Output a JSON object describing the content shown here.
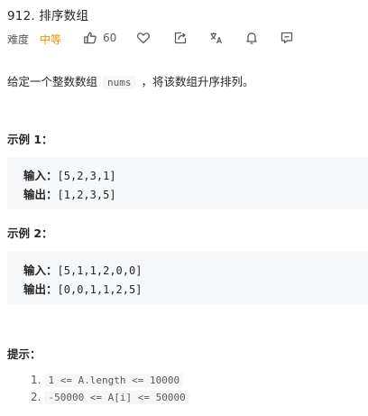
{
  "problem": {
    "title": "912. 排序数组",
    "difficulty_label": "难度",
    "difficulty": "中等",
    "likes": "60",
    "description_before": "给定一个整数数组",
    "description_code": "nums",
    "description_after": "，将该数组升序排列。"
  },
  "icons": {
    "like": "thumbs-up-icon",
    "favorite": "heart-icon",
    "share": "share-icon",
    "translate": "translate-icon",
    "notify": "bell-icon",
    "feedback": "comment-icon"
  },
  "examples": [
    {
      "title": "示例 1：",
      "input_label": "输入：",
      "input_value": "[5,2,3,1]",
      "output_label": "输出：",
      "output_value": "[1,2,3,5]"
    },
    {
      "title": "示例 2：",
      "input_label": "输入：",
      "input_value": "[5,1,1,2,0,0]",
      "output_label": "输出：",
      "output_value": "[0,0,1,1,2,5]"
    }
  ],
  "hints": {
    "title": "提示：",
    "items": [
      {
        "num": "1.",
        "code": "1 <= A.length <= 10000"
      },
      {
        "num": "2.",
        "code": "-50000 <= A[i] <= 50000"
      }
    ]
  },
  "colors": {
    "difficulty_medium": "#ef8f00",
    "text": "#262626",
    "muted": "#595959",
    "code_bg": "#f7f8fa"
  }
}
